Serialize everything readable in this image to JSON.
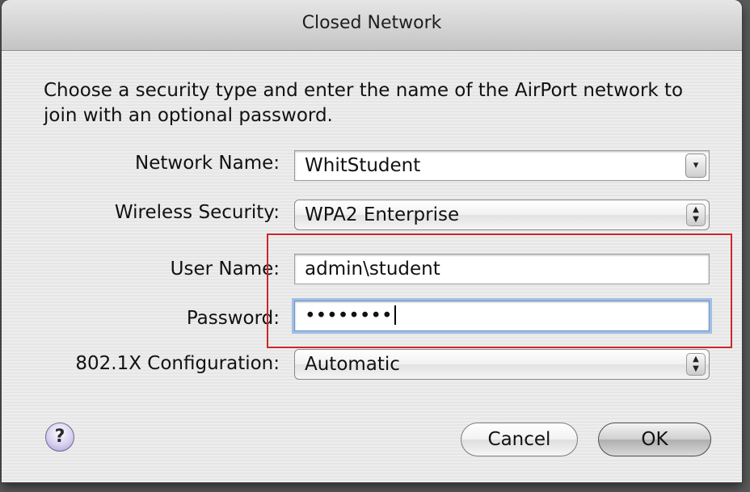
{
  "window": {
    "title": "Closed Network"
  },
  "instructions": "Choose a security type and enter the name of the AirPort network to join with an optional password.",
  "form": {
    "network_name": {
      "label": "Network Name:",
      "value": "WhitStudent",
      "arrow": "▾"
    },
    "wireless_security": {
      "label": "Wireless Security:",
      "selected": "WPA2 Enterprise",
      "arrows": "▲▼"
    },
    "user_name": {
      "label": "User Name:",
      "value": "admin\\student"
    },
    "password": {
      "label": "Password:",
      "value": "••••••••"
    },
    "config_8021x": {
      "label": "802.1X Configuration:",
      "selected": "Automatic",
      "arrows": "▲▼"
    }
  },
  "buttons": {
    "help": "?",
    "cancel": "Cancel",
    "ok": "OK"
  },
  "colors": {
    "highlight_box": "#c8292b",
    "focus_ring": "#9fbfe6"
  }
}
